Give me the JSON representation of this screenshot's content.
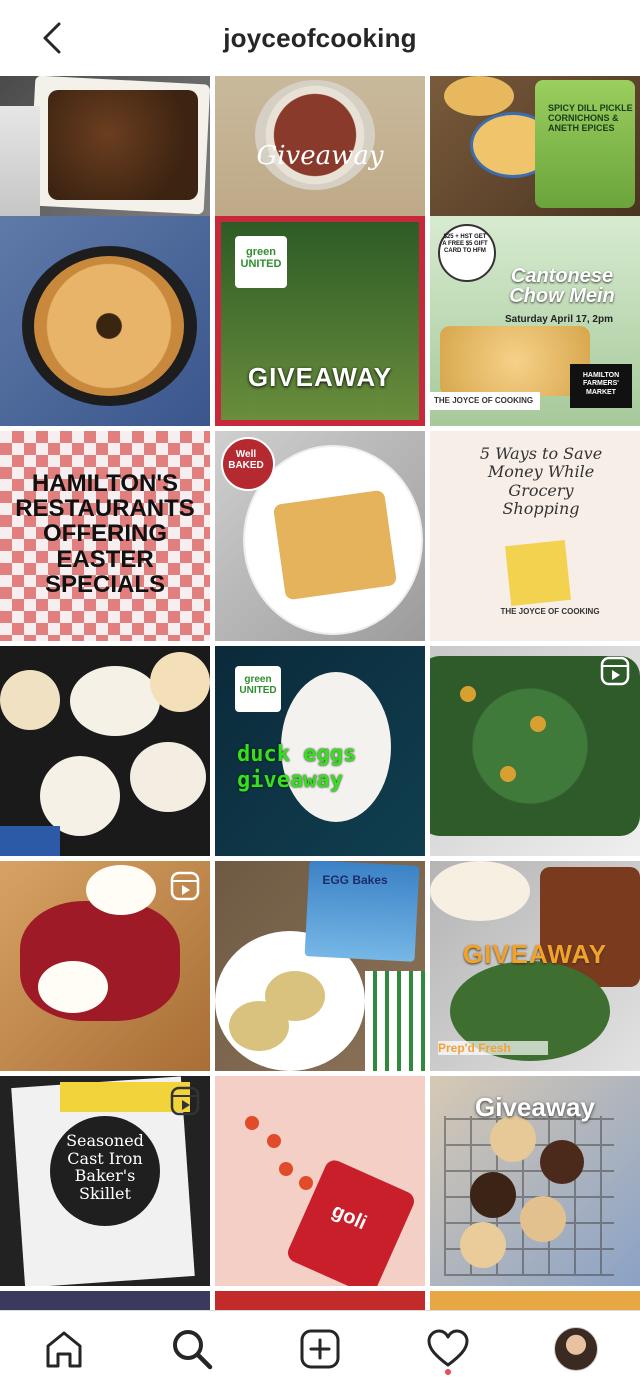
{
  "header": {
    "username": "joyceofcooking"
  },
  "grid": {
    "posts": [
      {
        "overlay": ""
      },
      {
        "overlay": "Giveaway"
      },
      {
        "overlay": "SPICY DILL PICKLE CORNICHONS & ANETH EPICES"
      },
      {
        "overlay": ""
      },
      {
        "overlay": "GIVEAWAY",
        "badge": "green UNITED"
      },
      {
        "overlay": "Cantonese Chow Mein",
        "sub": "Saturday April 17, 2pm",
        "sticker": "$25 + HST GET A FREE $5 GIFT CARD TO HFM",
        "brand": "THE JOYCE OF COOKING",
        "logo": "HAMILTON FARMERS' MARKET"
      },
      {
        "overlay": "HAMILTON'S RESTAURANTS OFFERING EASTER SPECIALS"
      },
      {
        "overlay": "",
        "badge": "Well BAKED"
      },
      {
        "overlay": "5 Ways to Save Money While Grocery Shopping",
        "brand": "THE JOYCE OF COOKING"
      },
      {
        "overlay": ""
      },
      {
        "overlay": "duck eggs giveaway",
        "badge": "green UNITED"
      },
      {
        "overlay": "",
        "reel": true
      },
      {
        "overlay": "",
        "reel": true
      },
      {
        "overlay": "EGG Bakes"
      },
      {
        "overlay": "GIVEAWAY",
        "brand": "Prep'd Fresh"
      },
      {
        "overlay": "Seasoned Cast Iron Baker's Skillet",
        "reel": true
      },
      {
        "overlay": "goli"
      },
      {
        "overlay": "Giveaway"
      }
    ]
  },
  "nav": {
    "items": [
      {
        "icon": "home-icon"
      },
      {
        "icon": "search-icon"
      },
      {
        "icon": "new-post-icon"
      },
      {
        "icon": "activity-heart-icon"
      },
      {
        "icon": "profile-avatar"
      }
    ]
  },
  "colors": {
    "accent": "#ed4956",
    "text": "#262626",
    "divider": "#dbdbdb"
  }
}
